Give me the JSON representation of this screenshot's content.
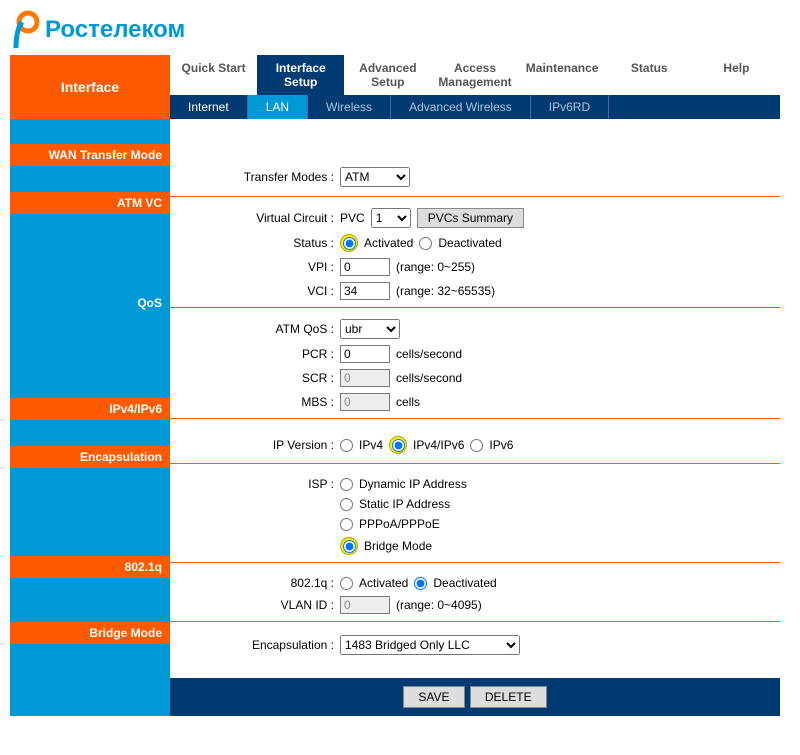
{
  "logo_text": "Ростелеком",
  "sidebar_title": "Interface",
  "top_tabs": [
    "Quick Start",
    "Interface Setup",
    "Advanced Setup",
    "Access Management",
    "Maintenance",
    "Status",
    "Help"
  ],
  "active_top_tab": 1,
  "sub_tabs": [
    "Internet",
    "LAN",
    "Wireless",
    "Advanced Wireless",
    "IPv6RD"
  ],
  "highlight_sub_tab": 1,
  "sections": {
    "wan_transfer_mode": "WAN Transfer Mode",
    "atm_vc": "ATM VC",
    "qos": "QoS",
    "ipv4_ipv6": "IPv4/IPv6",
    "encapsulation": "Encapsulation",
    "dot1q": "802.1q",
    "bridge_mode": "Bridge Mode"
  },
  "labels": {
    "transfer_modes": "Transfer Modes :",
    "virtual_circuit": "Virtual Circuit :",
    "pvc": "PVC",
    "pvcs_summary": "PVCs Summary",
    "status": "Status :",
    "activated": "Activated",
    "deactivated": "Deactivated",
    "vpi": "VPI :",
    "vpi_range": "(range: 0~255)",
    "vci": "VCI :",
    "vci_range": "(range: 32~65535)",
    "atm_qos": "ATM QoS :",
    "pcr": "PCR :",
    "scr": "SCR :",
    "mbs": "MBS :",
    "cells_sec": "cells/second",
    "cells": "cells",
    "ip_version": "IP Version :",
    "ipv4": "IPv4",
    "ipv4_ipv6": "IPv4/IPv6",
    "ipv6": "IPv6",
    "isp": "ISP :",
    "dynamic_ip": "Dynamic IP Address",
    "static_ip": "Static IP Address",
    "pppoa": "PPPoA/PPPoE",
    "bridge": "Bridge Mode",
    "dot1q": "802.1q :",
    "vlan_id": "VLAN ID :",
    "vlan_range": "(range: 0~4095)",
    "encaps_label": "Encapsulation :",
    "save": "SAVE",
    "delete": "DELETE"
  },
  "values": {
    "transfer_mode": "ATM",
    "pvc_index": "1",
    "status": "activated",
    "vpi": "0",
    "vci": "34",
    "atm_qos": "ubr",
    "pcr": "0",
    "scr": "0",
    "mbs": "0",
    "ip_version": "ipv4_ipv6",
    "isp": "bridge",
    "dot1q": "deactivated",
    "vlan_id": "0",
    "encapsulation": "1483 Bridged Only LLC"
  }
}
